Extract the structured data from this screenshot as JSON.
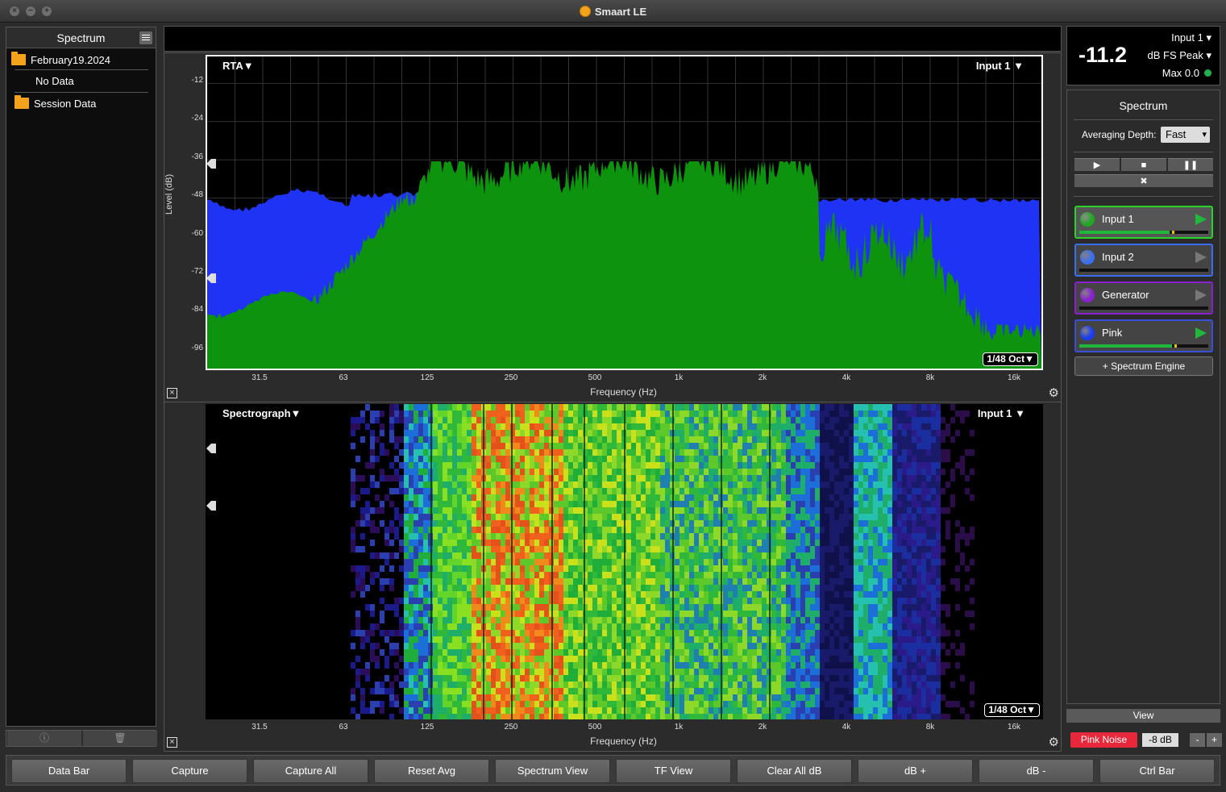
{
  "window": {
    "title": "Smaart LE"
  },
  "left_panel": {
    "title": "Spectrum",
    "items": [
      {
        "label": "February19.2024",
        "type": "folder-open"
      },
      {
        "label": "No Data",
        "type": "item"
      },
      {
        "label": "Session Data",
        "type": "folder"
      }
    ],
    "bottom_buttons": [
      "info-icon",
      "trash-icon"
    ]
  },
  "rta": {
    "mode_label": "RTA",
    "input_label": "Input 1",
    "resolution": "1/48 Oct",
    "ylabel": "Level (dB)",
    "xlabel": "Frequency (Hz)",
    "yticks": [
      "-12",
      "-24",
      "-36",
      "-48",
      "-60",
      "-72",
      "-84",
      "-96"
    ],
    "xticks": [
      "31.5",
      "63",
      "125",
      "250",
      "500",
      "1k",
      "2k",
      "4k",
      "8k",
      "16k"
    ]
  },
  "spectrograph": {
    "mode_label": "Spectrograph",
    "input_label": "Input 1",
    "resolution": "1/48 Oct",
    "xlabel": "Frequency (Hz)",
    "xticks": [
      "31.5",
      "63",
      "125",
      "250",
      "500",
      "1k",
      "2k",
      "4k",
      "8k",
      "16k"
    ]
  },
  "meter": {
    "value": "-11.2",
    "input": "Input 1",
    "units": "dB FS Peak",
    "max": "Max 0.0",
    "status_color": "#22b14c"
  },
  "spectrum_panel": {
    "title": "Spectrum",
    "avg_label": "Averaging Depth:",
    "avg_value": "Fast",
    "transport": [
      "play-icon",
      "stop-icon",
      "pause-icon"
    ],
    "tools_icon": "tools-icon",
    "engines": [
      {
        "name": "Input 1",
        "color": "#1fa81f",
        "border": "#2ad32a",
        "level": 0.7,
        "active": true
      },
      {
        "name": "Input 2",
        "color": "#3a6ef0",
        "border": "#3a6ef0",
        "level": 0.0,
        "active": false
      },
      {
        "name": "Generator",
        "color": "#8a1fd0",
        "border": "#8a1fd0",
        "level": 0.0,
        "active": false
      },
      {
        "name": "Pink",
        "color": "#1a3cf0",
        "border": "#3a4fd8",
        "level": 0.72,
        "active": true
      }
    ],
    "add_engine": "+ Spectrum Engine"
  },
  "view_button": "View",
  "generator": {
    "label": "Pink Noise",
    "level": "-8 dB",
    "minus": "-",
    "plus": "+"
  },
  "bottom_bar": [
    "Data Bar",
    "Capture",
    "Capture All",
    "Reset Avg",
    "Spectrum View",
    "TF View",
    "Clear All dB",
    "dB +",
    "dB -",
    "Ctrl Bar"
  ],
  "colors": {
    "rta_blue": "#1f33f5",
    "rta_green": "#0d930d",
    "alert_red": "#e8283a"
  }
}
